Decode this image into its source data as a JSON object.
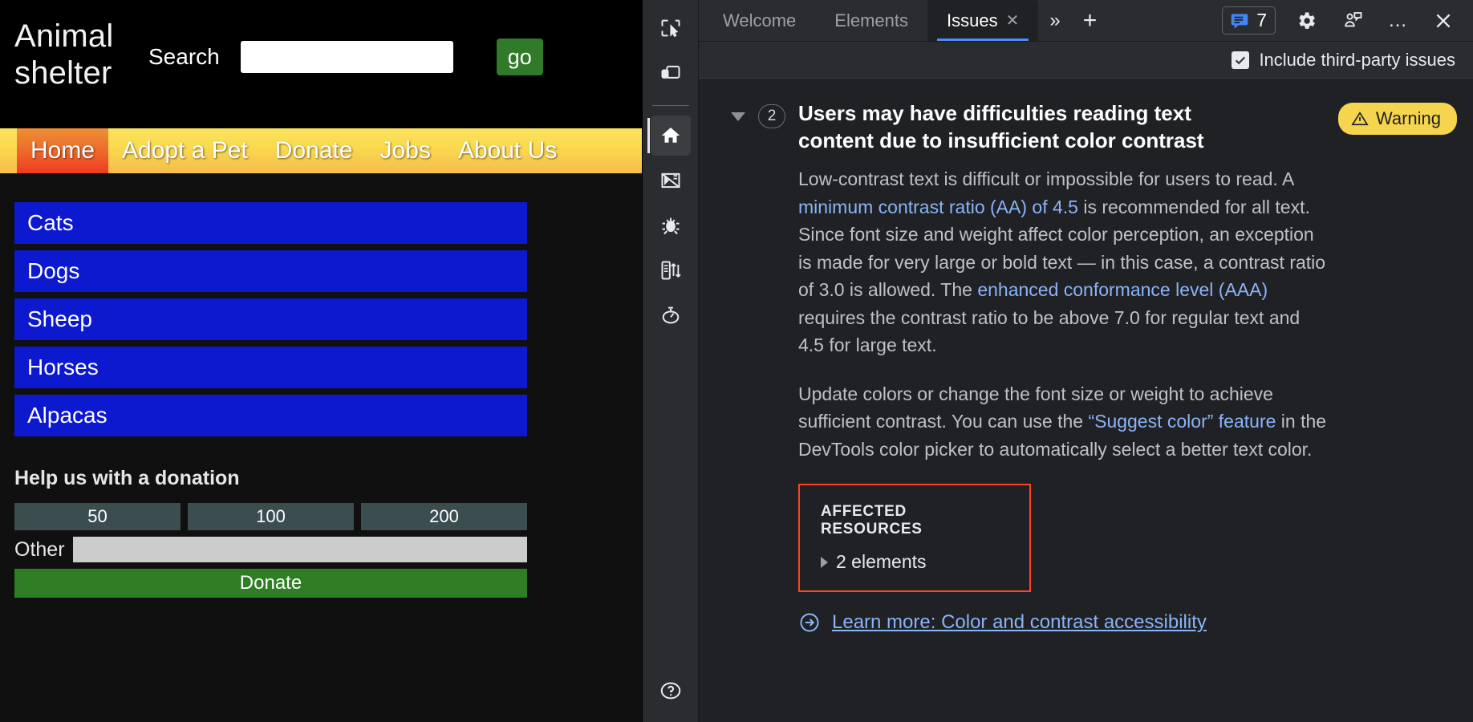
{
  "page": {
    "logo": "Animal shelter",
    "search": {
      "label": "Search",
      "value": "",
      "placeholder": "",
      "go_label": "go"
    },
    "nav": [
      {
        "label": "Home",
        "active": true
      },
      {
        "label": "Adopt a Pet",
        "active": false
      },
      {
        "label": "Donate",
        "active": false
      },
      {
        "label": "Jobs",
        "active": false
      },
      {
        "label": "About Us",
        "active": false
      }
    ],
    "animals": [
      "Cats",
      "Dogs",
      "Sheep",
      "Horses",
      "Alpacas"
    ],
    "donation": {
      "heading": "Help us with a donation",
      "amounts": [
        "50",
        "100",
        "200"
      ],
      "other_label": "Other",
      "other_value": "",
      "submit_label": "Donate"
    },
    "colors": {
      "nav_active": "#ef3b23",
      "animal_button": "#0d19cf",
      "go_button": "#317a2a",
      "donate_button": "#2f7d24",
      "amount_button": "#3b4d4f"
    }
  },
  "devtools": {
    "rail": [
      {
        "name": "inspect-element-icon",
        "title": "inspect"
      },
      {
        "name": "device-toolbar-icon",
        "title": "device"
      },
      {
        "name": "home-icon",
        "title": "home",
        "selected": true
      },
      {
        "name": "elements-panel-icon",
        "title": "elements"
      },
      {
        "name": "bug-icon",
        "title": "debugger"
      },
      {
        "name": "network-icon",
        "title": "network"
      },
      {
        "name": "performance-timer-icon",
        "title": "performance"
      },
      {
        "name": "help-icon",
        "title": "help"
      }
    ],
    "tabs": [
      {
        "label": "Welcome",
        "active": false,
        "closable": false
      },
      {
        "label": "Elements",
        "active": false,
        "closable": false
      },
      {
        "label": "Issues",
        "active": true,
        "closable": true
      }
    ],
    "tab_more_label": "»",
    "tab_add_label": "+",
    "issues_badge_count": "7",
    "toolbar_more_label": "…",
    "third_party": {
      "label": "Include third-party issues",
      "checked": true
    },
    "issue": {
      "count": "2",
      "title": "Users may have difficulties reading text content due to insufficient color contrast",
      "severity_label": "Warning",
      "severity_color": "#f5d44e",
      "paragraph1_a": "Low-contrast text is difficult or impossible for users to read. A ",
      "paragraph1_link1": "minimum contrast ratio (AA) of 4.5",
      "paragraph1_b": " is recommended for all text. Since font size and weight affect color perception, an exception is made for very large or bold text — in this case, a contrast ratio of 3.0 is allowed. The ",
      "paragraph1_link2": "enhanced conformance level (AAA)",
      "paragraph1_c": " requires the contrast ratio to be above 7.0 for regular text and 4.5 for large text.",
      "paragraph2_a": "Update colors or change the font size or weight to achieve sufficient contrast. You can use the ",
      "paragraph2_link1": "“Suggest color” feature",
      "paragraph2_b": " in the DevTools color picker to automatically select a better text color.",
      "affected_title": "AFFECTED RESOURCES",
      "affected_count": "2 elements",
      "affected_highlight_color": "#ff4323",
      "learn_more": "Learn more: Color and contrast accessibility"
    }
  }
}
